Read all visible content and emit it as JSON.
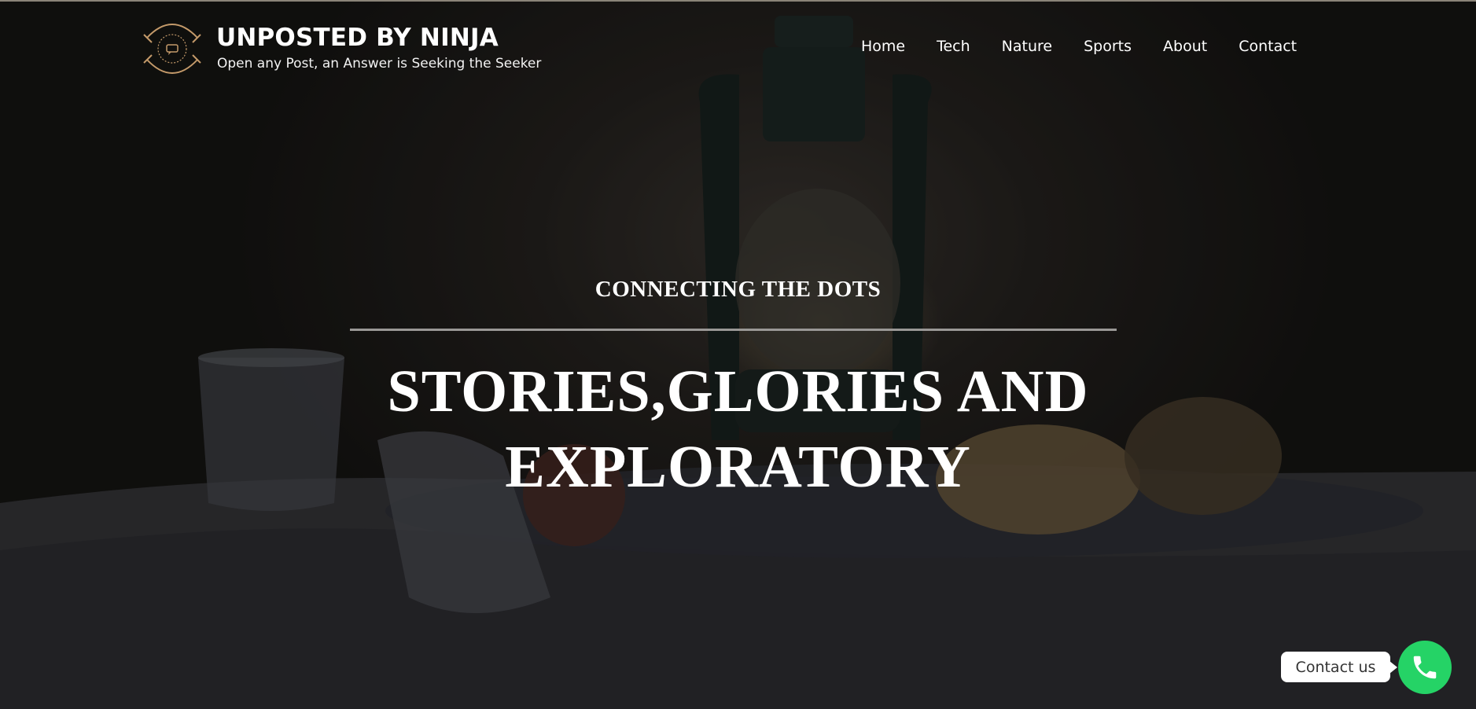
{
  "site": {
    "title": "UNPOSTED BY NINJA",
    "tagline": "Open any Post, an Answer is Seeking the Seeker",
    "logo_icon": "ninja-emblem-icon"
  },
  "nav": {
    "items": [
      {
        "label": "Home"
      },
      {
        "label": "Tech"
      },
      {
        "label": "Nature"
      },
      {
        "label": "Sports"
      },
      {
        "label": "About"
      },
      {
        "label": "Contact"
      }
    ]
  },
  "hero": {
    "eyebrow": "CONNECTING THE DOTS",
    "headline_line1": "STORIES,GLORIES AND",
    "headline_line2": "EXPLORATORY",
    "background": "still-life-lantern-image"
  },
  "contact_widget": {
    "label": "Contact us",
    "icon": "phone-icon",
    "color": "#25d366"
  }
}
